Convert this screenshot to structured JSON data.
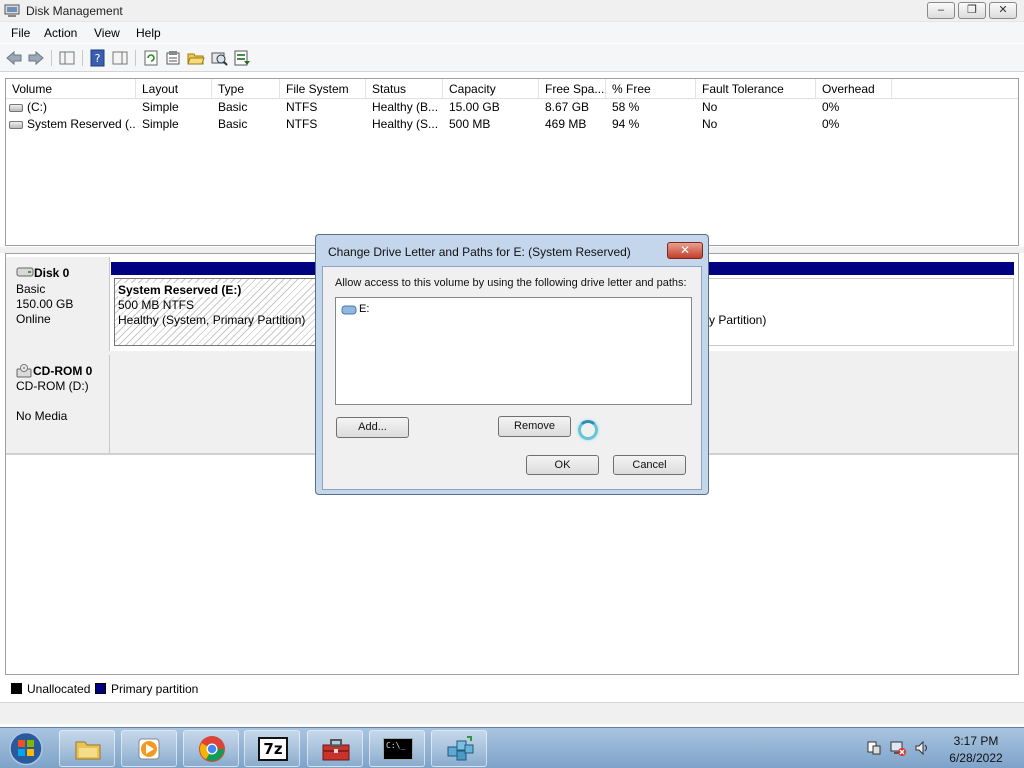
{
  "window": {
    "title": "Disk Management",
    "controls": {
      "minimize": "–",
      "restore": "❐",
      "close": "✕"
    }
  },
  "menu": [
    "File",
    "Action",
    "View",
    "Help"
  ],
  "toolbar_icons": [
    "back-icon",
    "forward-icon",
    "show-hide-console-tree-icon",
    "help-icon",
    "show-hide-action-pane-icon",
    "refresh-icon",
    "properties-icon",
    "open-icon",
    "rescan-icon",
    "export-list-icon"
  ],
  "volume_table": {
    "columns": [
      "Volume",
      "Layout",
      "Type",
      "File System",
      "Status",
      "Capacity",
      "Free Spa...",
      "% Free",
      "Fault Tolerance",
      "Overhead"
    ],
    "rows": [
      [
        "(C:)",
        "Simple",
        "Basic",
        "NTFS",
        "Healthy (B...",
        "15.00 GB",
        "8.67 GB",
        "58 %",
        "No",
        "0%"
      ],
      [
        "System Reserved (...",
        "Simple",
        "Basic",
        "NTFS",
        "Healthy (S...",
        "500 MB",
        "469 MB",
        "94 %",
        "No",
        "0%"
      ]
    ]
  },
  "disks": {
    "disk0": {
      "name": "Disk 0",
      "type": "Basic",
      "size": "150.00 GB",
      "state": "Online",
      "partition": {
        "name": "System Reserved  (E:)",
        "size": "500 MB NTFS",
        "status": "Healthy (System, Primary Partition)"
      },
      "partition2_status_tail": "y Partition)"
    },
    "cdrom0": {
      "name": "CD-ROM 0",
      "drive": "CD-ROM (D:)",
      "media": "No Media"
    }
  },
  "legend": {
    "unallocated": "Unallocated",
    "primary": "Primary partition",
    "colors": {
      "unallocated": "#000000",
      "primary": "#000080"
    }
  },
  "dialog": {
    "title": "Change Drive Letter and Paths for E: (System Reserved)",
    "close": "✕",
    "message": "Allow access to this volume by using the following drive letter and paths:",
    "paths": [
      "E:"
    ],
    "add_button": "Add...",
    "remove_button": "Remove",
    "ok_button": "OK",
    "cancel_button": "Cancel"
  },
  "taskbar": {
    "apps": [
      "windows-explorer-icon",
      "media-player-icon",
      "chrome-icon",
      "7zip-icon",
      "toolbox-icon",
      "command-prompt-icon",
      "network-cubes-icon"
    ],
    "sevenzip_label": "7z",
    "cmd_label": "C:\\_",
    "time": "3:17 PM",
    "date": "6/28/2022"
  }
}
